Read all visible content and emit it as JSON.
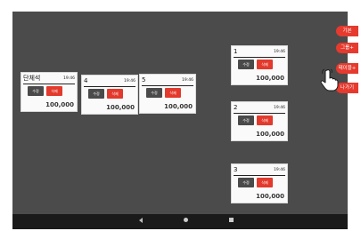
{
  "tables": [
    {
      "name": "단체석",
      "time": "19:46",
      "edit_label": "수정",
      "delete_label": "삭제",
      "amount": "100,000"
    },
    {
      "name": "4",
      "time": "19:46",
      "edit_label": "수정",
      "delete_label": "삭제",
      "amount": "100,000"
    },
    {
      "name": "5",
      "time": "19:46",
      "edit_label": "수정",
      "delete_label": "삭제",
      "amount": "100,000"
    },
    {
      "name": "1",
      "time": "19:46",
      "edit_label": "수정",
      "delete_label": "삭제",
      "amount": "100,000"
    },
    {
      "name": "2",
      "time": "19:46",
      "edit_label": "수정",
      "delete_label": "삭제",
      "amount": "100,000"
    },
    {
      "name": "3",
      "time": "19:46",
      "edit_label": "수정",
      "delete_label": "삭제",
      "amount": "100,000"
    }
  ],
  "side_menu": {
    "basic": "기본",
    "group_add": "그룹+",
    "table_add": "테이블+",
    "exit": "나가기"
  },
  "colors": {
    "canvas_bg": "#4b4b4b",
    "accent": "#e63a2e",
    "edit_button": "#4a4a4a",
    "nav_bar": "#1a1a1a"
  },
  "nav_icons": [
    "back-icon",
    "home-icon",
    "recent-apps-icon"
  ]
}
